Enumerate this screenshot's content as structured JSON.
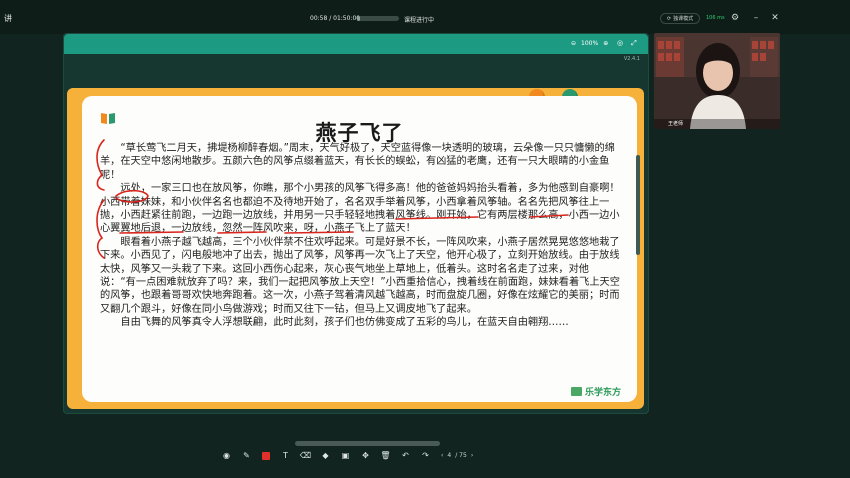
{
  "topbar": {
    "app_title": "讲",
    "time": "00:58 / 01:50:00",
    "progress_fraction": 0.01,
    "status": "课程进行中",
    "sync_label": "独课模式",
    "network": "106 ms"
  },
  "frame": {
    "zoom": "100%",
    "version": "V2.4.1"
  },
  "slide": {
    "title": "燕子飞了",
    "paragraphs": [
      "“草长莺飞二月天，拂堤杨柳醉春烟。”周末，天气好极了，天空蓝得像一块透明的玻璃，云朵像一只只慵懒的绵羊，在天空中悠闲地散步。五颜六色的风筝点缀着蓝天，有长长的蜈蚣，有凶猛的老鹰，还有一只大眼睛的小金鱼呢！",
      "远处，一家三口也在放风筝，你瞧，那个小男孩的风筝飞得多高！他的爸爸妈妈抬头看着，多为他感到自豪啊！小西带着妹妹，和小伙伴名名也都迫不及待地开始了，名名双手举着风筝，小西拿着风筝轴。名名先把风筝往上一抛，小西赶紧往前跑，一边跑一边放线，并用另一只手轻轻地拽着风筝线。刚开始，它有两层楼那么高，小西一边小心翼翼地后退，一边放线，忽然一阵风吹来，呀，小燕子飞上了蓝天！",
      "眼看着小燕子越飞越高，三个小伙伴禁不住欢呼起来。可是好景不长，一阵风吹来，小燕子居然晃晃悠悠地栽了下来。小西见了，闪电般地冲了出去，抛出了风筝，风筝再一次飞上了天空，他开心极了，立刻开始放线。由于放线太快，风筝又一头栽了下来。这回小西伤心起来，灰心丧气地坐上草地上，低着头。这时名名走了过来，对他说：“有一点困难就放弃了吗？来，我们一起把风筝放上天空！”小西重拾信心，拽着线在前面跑，妹妹看着飞上天空的风筝，也跟着哥哥欢快地奔跑着。这一次，小燕子驾着清风越飞越高，时而盘旋几圈，好像在炫耀它的美丽；时而又翻几个跟斗，好像在同小鸟做游戏；时而又往下一钻，但马上又调皮地飞了起来。",
      "自由飞舞的风筝真令人浮想联翩，此时此刻，孩子们也仿佛变成了五彩的鸟儿，在蓝天自由翱翔……"
    ],
    "brand": "乐学东方"
  },
  "bottombar": {
    "page_current": "4",
    "page_total": "/ 75"
  },
  "video": {
    "name": "王老师"
  },
  "colors": {
    "accent": "#1d9b82",
    "slide_border": "#f6b13a",
    "ink": "#d9251d"
  }
}
